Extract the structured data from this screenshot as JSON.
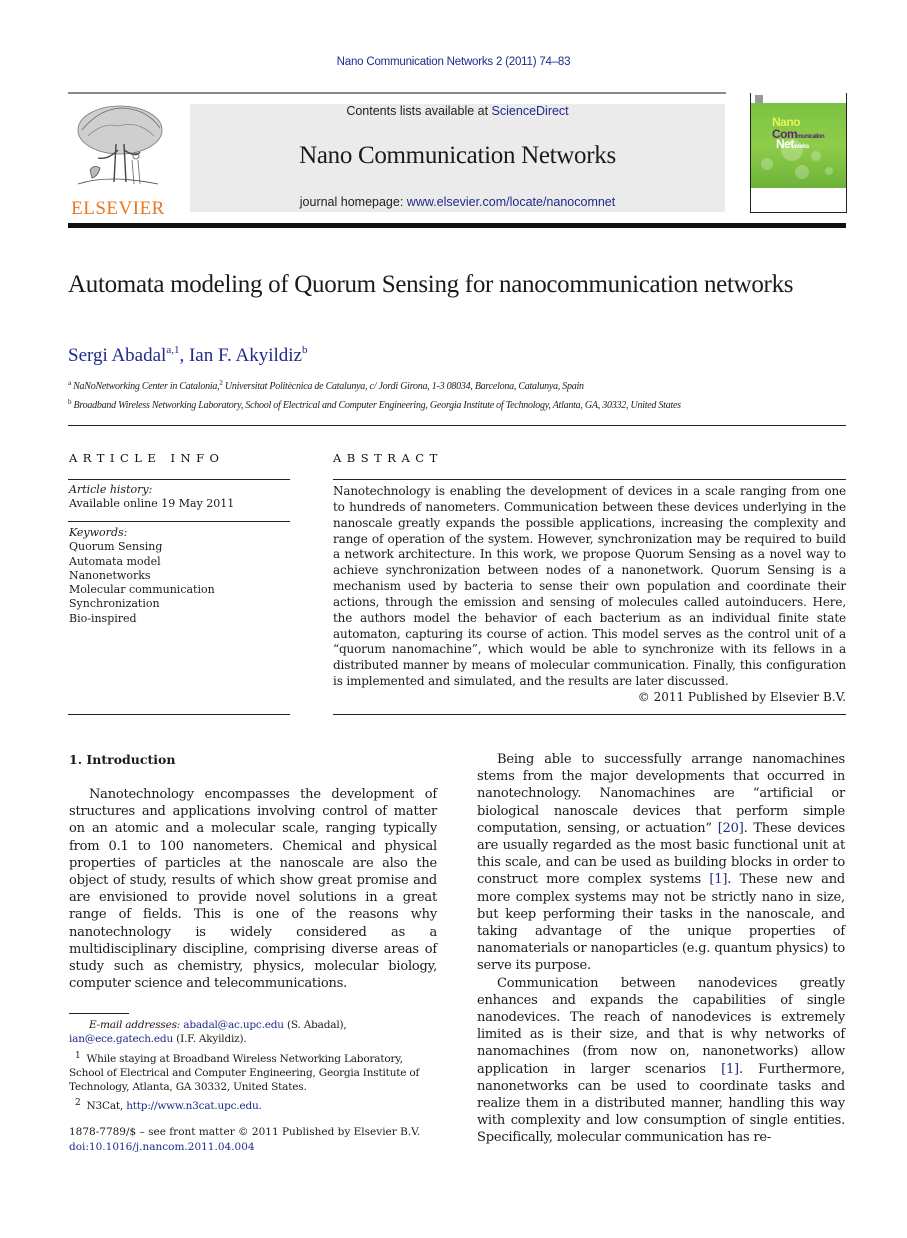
{
  "running_header": "Nano Communication Networks 2 (2011) 74–83",
  "publisher": {
    "logo_word": "ELSEVIER",
    "logo_color": "#e87722"
  },
  "banner": {
    "contents_prefix": "Contents lists available at ",
    "contents_link": "ScienceDirect",
    "journal_title": "Nano Communication Networks",
    "homepage_prefix": "journal homepage: ",
    "homepage_link": "www.elsevier.com/locate/nanocomnet"
  },
  "cover": {
    "line1": "Nano",
    "line2_big": "Com",
    "line2_small": "munication",
    "line3_big": "Net",
    "line3_small": "works"
  },
  "article": {
    "title": "Automata modeling of Quorum Sensing for nanocommunication networks",
    "authors": [
      {
        "name": "Sergi Abadal",
        "sup": "a,1"
      },
      {
        "name": "Ian F. Akyildiz",
        "sup": "b"
      }
    ],
    "author_separator": ", ",
    "affiliations": [
      {
        "label": "a",
        "text_before": "NaNoNetworking Center in Catalonia,",
        "sup": "2",
        "text_after": " Universitat Politècnica de Catalunya, c/ Jordi Girona, 1-3 08034, Barcelona, Catalunya, Spain"
      },
      {
        "label": "b",
        "text_before": "Broadband Wireless Networking Laboratory, School of Electrical and Computer Engineering, Georgia Institute of Technology, Atlanta, GA, 30332, United States",
        "sup": "",
        "text_after": ""
      }
    ]
  },
  "article_info": {
    "heading": "ARTICLE INFO",
    "history_label": "Article history:",
    "history_value": "Available online 19 May 2011",
    "keywords_label": "Keywords:",
    "keywords": [
      "Quorum Sensing",
      "Automata model",
      "Nanonetworks",
      "Molecular communication",
      "Synchronization",
      "Bio-inspired"
    ]
  },
  "abstract": {
    "heading": "ABSTRACT",
    "text": "Nanotechnology is enabling the development of devices in a scale ranging from one to hundreds of nanometers. Communication between these devices underlying in the nanoscale greatly expands the possible applications, increasing the complexity and range of operation of the system. However, synchronization may be required to build a network architecture. In this work, we propose Quorum Sensing as a novel way to achieve synchronization between nodes of a nanonetwork. Quorum Sensing is a mechanism used by bacteria to sense their own population and coordinate their actions, through the emission and sensing of molecules called autoinducers. Here, the authors model the behavior of each bacterium as an individual finite state automaton, capturing its course of action. This model serves as the control unit of a “quorum nanomachine”, which would be able to synchronize with its fellows in a distributed manner by means of molecular communication. Finally, this configuration is implemented and simulated, and the results are later discussed.",
    "copyright": "© 2011 Published by Elsevier B.V."
  },
  "body": {
    "section_heading": "1.  Introduction",
    "left_paragraph": "Nanotechnology encompasses the development of structures and applications involving control of matter on an atomic and a molecular scale, ranging typically from 0.1 to 100 nanometers. Chemical and physical properties of particles at the nanoscale are also the object of study, results of which show great promise and are envisioned to provide novel solutions in a great range of fields. This is one of the reasons why nanotechnology is widely considered as a multidisciplinary discipline, comprising diverse areas of study such as chemistry, physics, molecular biology, computer science and telecommunications.",
    "right_p1": {
      "a": "Being able to successfully arrange nanomachines stems from the major developments that occurred in nanotechnology. Nanomachines are “artificial or biological nanoscale devices that perform simple computation, sensing, or actuation” ",
      "ref1": "[20]",
      "b": ". These devices are usually regarded as the most basic functional unit at this scale, and can be used as building blocks in order to construct more complex systems ",
      "ref2": "[1]",
      "c": ". These new and more complex systems may not be strictly nano in size, but keep performing their tasks in the nanoscale, and taking advantage of the unique properties of nanomaterials or nanoparticles (e.g. quantum physics) to serve its purpose."
    },
    "right_p2": {
      "a": "Communication between nanodevices greatly enhances and expands the capabilities of single nanodevices. The reach of nanodevices is extremely limited as is their size, and that is why networks of nanomachines (from now on, nanonetworks) allow application in larger scenarios ",
      "ref1": "[1]",
      "b": ". Furthermore, nanonetworks can be used to coordinate tasks and realize them in a distributed manner, handling this way with complexity and low consumption of single entities. Specifically, molecular communication has re-"
    }
  },
  "footnotes": {
    "email_label": "E-mail addresses:",
    "email1": "abadal@ac.upc.edu",
    "email1_owner": " (S. Abadal), ",
    "email2": "ian@ece.gatech.edu",
    "email2_owner": " (I.F. Akyildiz).",
    "fn1_mark": "1",
    "fn1_text": "While staying at Broadband Wireless Networking Laboratory, School of Electrical and Computer Engineering, Georgia Institute of Technology, Atlanta, GA 30332, United States.",
    "fn2_mark": "2",
    "fn2_text_before": "N3Cat, ",
    "fn2_link": "http://www.n3cat.upc.edu",
    "fn2_text_after": "."
  },
  "front_matter": {
    "issn_line": "1878-7789/$ – see front matter © 2011 Published by Elsevier B.V.",
    "doi": "doi:10.1016/j.nancom.2011.04.004"
  },
  "colors": {
    "link": "#1f2a8a",
    "banner_bg": "#ebebeb",
    "cover_green": "#7cc242"
  }
}
